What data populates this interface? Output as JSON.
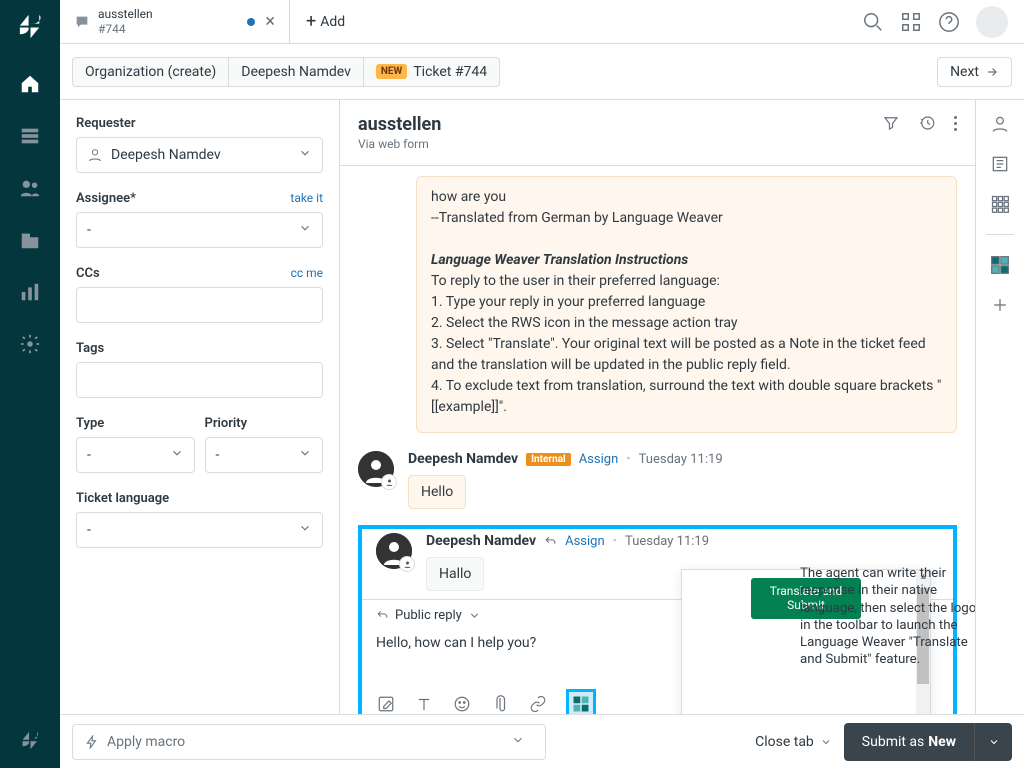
{
  "tab": {
    "title": "ausstellen",
    "sub": "#744"
  },
  "add_tab": "Add",
  "breadcrumb": {
    "org": "Organization (create)",
    "user": "Deepesh Namdev",
    "new_badge": "NEW",
    "ticket": "Ticket #744"
  },
  "next_btn": "Next",
  "sidebar": {
    "requester_label": "Requester",
    "requester_value": "Deepesh Namdev",
    "assignee_label": "Assignee*",
    "assignee_link": "take it",
    "assignee_value": "-",
    "ccs_label": "CCs",
    "ccs_link": "cc me",
    "tags_label": "Tags",
    "type_label": "Type",
    "type_value": "-",
    "priority_label": "Priority",
    "priority_value": "-",
    "lang_label": "Ticket language",
    "lang_value": "-"
  },
  "convo": {
    "title": "ausstellen",
    "via": "Via web form"
  },
  "note": {
    "line1": "how are you",
    "line2": "--Translated from German by Language Weaver",
    "heading": "Language Weaver Translation Instructions",
    "l3": "To reply to the user in their preferred language:",
    "l4": "1. Type your reply in your preferred language",
    "l5": "2. Select the RWS icon in the message action tray",
    "l6": "3. Select \"Translate\". Your original text will be posted as a Note in the ticket feed and the translation will be updated in the public reply field.",
    "l7": "4. To exclude text from translation, surround the text with double square brackets \"[[example]]\"."
  },
  "msg1": {
    "author": "Deepesh Namdev",
    "badge": "Internal",
    "assign": "Assign",
    "ts": "Tuesday 11:19",
    "body": "Hello"
  },
  "msg2": {
    "author": "Deepesh Namdev",
    "assign": "Assign",
    "ts": "Tuesday 11:19",
    "body": "Hallo"
  },
  "popup_btn": "Translate and Submit",
  "reply_mode": "Public reply",
  "editor_text": "Hello, how can I help you?",
  "callout": "The agent can write their response in their native language, then select the logo in the toolbar to launch the Language Weaver \"Translate and Submit\" feature.",
  "footer": {
    "macro": "Apply macro",
    "close": "Close tab",
    "submit_pre": "Submit as ",
    "submit_state": "New"
  }
}
